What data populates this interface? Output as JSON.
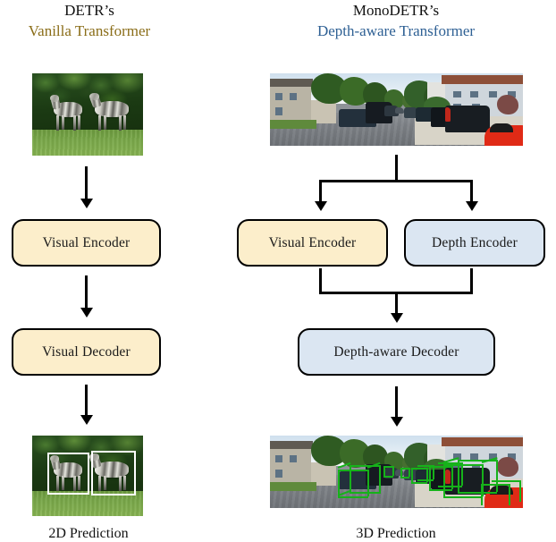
{
  "figure": {
    "left_column": {
      "heading_line1": "DETR’s",
      "heading_line2": "Vanilla Transformer",
      "heading_color": "#8a6d18",
      "top_image": {
        "alt": "Two zebras standing on grass in front of dense green foliage",
        "scene": "zebras"
      },
      "blocks": [
        {
          "label": "Visual Encoder",
          "fill": "#fceecb",
          "kind": "encoder"
        },
        {
          "label": "Visual Decoder",
          "fill": "#fceecb",
          "kind": "decoder"
        }
      ],
      "bottom_image": {
        "alt": "Same zebra photo with two white 2D bounding boxes drawn around each zebra",
        "scene": "zebras-with-2d-boxes",
        "box_color": "#ffffff",
        "box_count": 2
      },
      "caption": "2D Prediction"
    },
    "right_column": {
      "heading_line1": "MonoDETR’s",
      "heading_line2": "Depth-aware Transformer",
      "heading_color": "#2e6094",
      "top_image": {
        "alt": "Suburban street scene with parked cars, houses and trees (KITTI)",
        "scene": "street"
      },
      "blocks": [
        {
          "label": "Visual Encoder",
          "fill": "#fceecb",
          "kind": "encoder"
        },
        {
          "label": "Depth Encoder",
          "fill": "#dbe6f2",
          "kind": "encoder"
        },
        {
          "label": "Depth-aware Decoder",
          "fill": "#dbe6f2",
          "kind": "decoder"
        }
      ],
      "bottom_image": {
        "alt": "Same street photo with green 3D bounding boxes drawn around the cars",
        "scene": "street-with-3d-boxes",
        "box_color": "#16b21a",
        "box_count": 7
      },
      "caption": "3D Prediction"
    },
    "colors": {
      "cream_block": "#fceecb",
      "blue_block": "#dbe6f2",
      "block_border": "#000000",
      "arrow": "#000000",
      "box_2d": "#ffffff",
      "box_3d": "#16b21a"
    }
  }
}
